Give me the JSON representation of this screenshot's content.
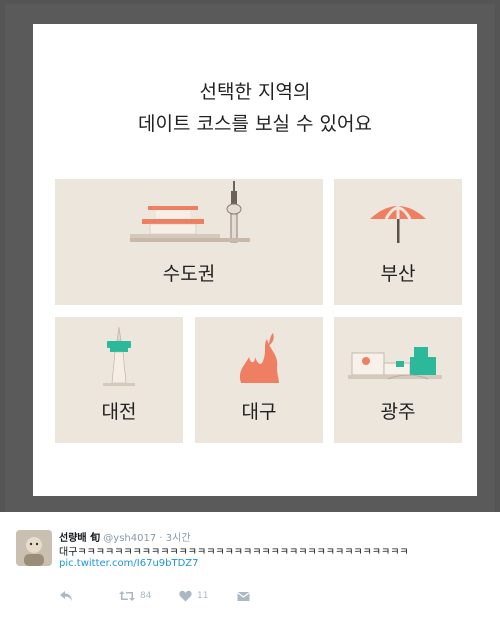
{
  "card": {
    "heading_line1": "선택한 지역의",
    "heading_line2": "데이트 코스를 보실 수 있어요"
  },
  "regions": [
    {
      "label": "수도권",
      "icon": "palace-and-tower-icon"
    },
    {
      "label": "부산",
      "icon": "beach-umbrella-icon"
    },
    {
      "label": "대전",
      "icon": "tower-icon"
    },
    {
      "label": "대구",
      "icon": "flame-icon"
    },
    {
      "label": "광주",
      "icon": "landmark-building-icon"
    }
  ],
  "tweet": {
    "name": "선량배 旬",
    "handle": "@ysh4017",
    "separator": "·",
    "time": "3시간",
    "text": "대구ㅋㅋㅋㅋㅋㅋㅋㅋㅋㅋㅋㅋㅋㅋㅋㅋㅋㅋㅋㅋㅋㅋㅋㅋㅋㅋㅋㅋㅋㅋㅋㅋㅋㅋㅋㅋ",
    "link": "pic.twitter.com/I67u9bTDZ7",
    "retweet_count": "84",
    "like_count": "11"
  },
  "colors": {
    "tile_bg": "#ede6dd",
    "coral": "#ee7f62",
    "teal": "#2cb89b",
    "dim_overlay": "#555555"
  }
}
